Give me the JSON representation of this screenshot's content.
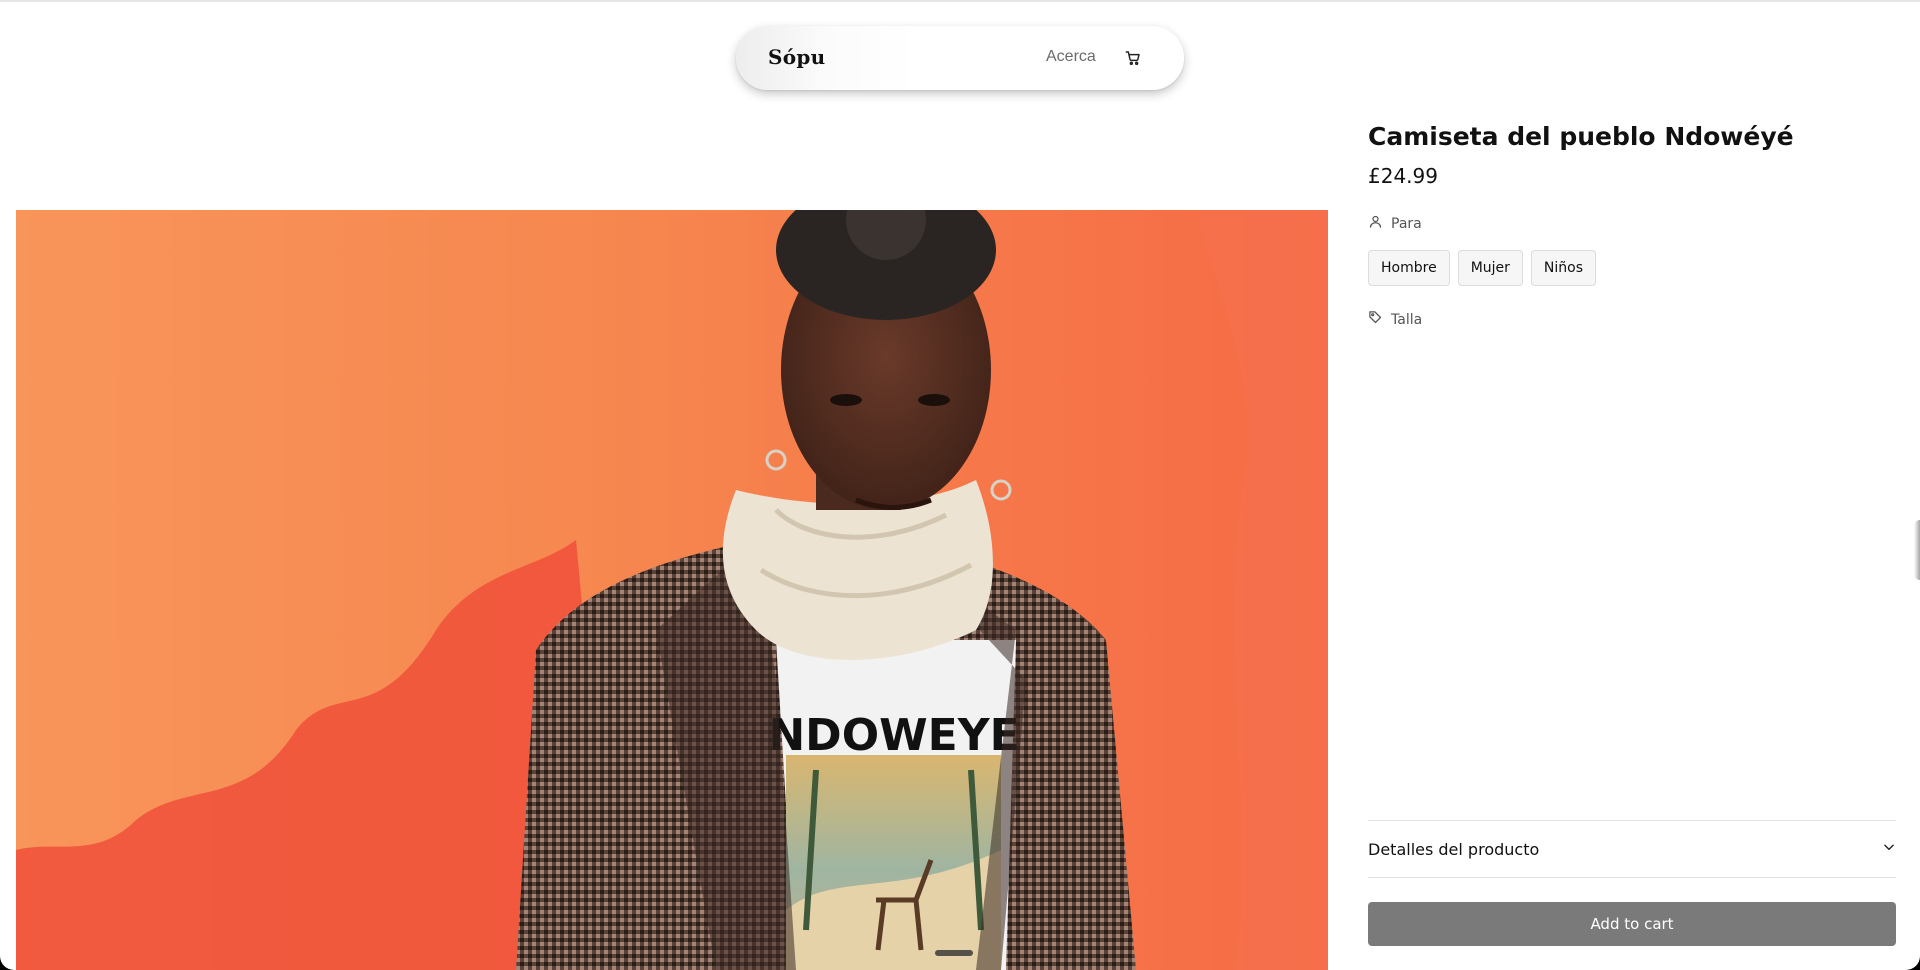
{
  "nav": {
    "brand": "Sópu",
    "about_label": "Acerca",
    "cart_icon": "cart-icon"
  },
  "product": {
    "title": "Camiseta del pueblo Ndowéyé",
    "price": "£24.99",
    "image_alt": "Mujer con abrigo de pata de gallo y bufanda, camiseta NDOWEYE",
    "shirt_print": "NDOWEYE"
  },
  "options": {
    "for": {
      "icon": "user-icon",
      "label": "Para",
      "choices": [
        "Hombre",
        "Mujer",
        "Niños"
      ]
    },
    "size": {
      "icon": "tag-icon",
      "label": "Talla"
    }
  },
  "details": {
    "label": "Detalles del producto",
    "icon": "chevron-down-icon"
  },
  "add_to_cart": "Add to cart",
  "colors": {
    "wall_orange": "#f57a4b",
    "button_gray": "#7a7a7a"
  }
}
